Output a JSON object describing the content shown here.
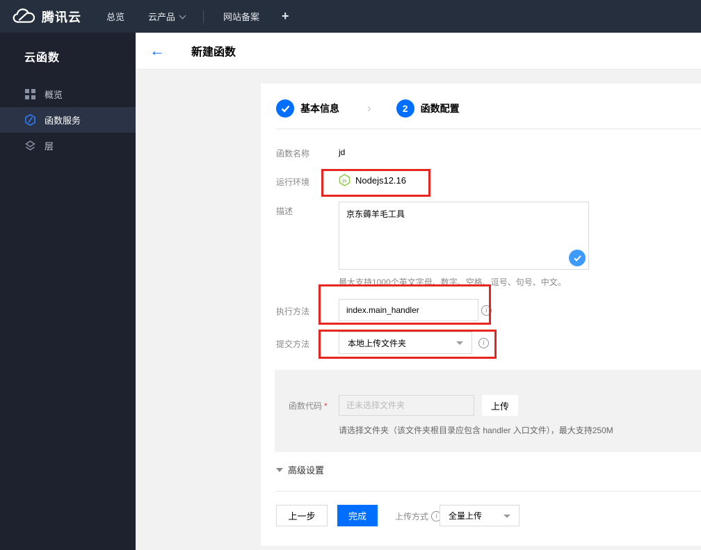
{
  "topnav": {
    "brand": "腾讯云",
    "items": [
      {
        "label": "总览"
      },
      {
        "label": "云产品"
      },
      {
        "label": "网站备案"
      },
      {
        "label": "+"
      }
    ]
  },
  "sidebar": {
    "title": "云函数",
    "items": [
      {
        "label": "概览",
        "active": false
      },
      {
        "label": "函数服务",
        "active": true
      },
      {
        "label": "层",
        "active": false
      }
    ]
  },
  "header": {
    "title": "新建函数"
  },
  "steps": [
    {
      "num": "1",
      "label": "基本信息",
      "state": "done"
    },
    {
      "num": "2",
      "label": "函数配置",
      "state": "current"
    }
  ],
  "form": {
    "function_name": {
      "label": "函数名称",
      "value": "jd"
    },
    "runtime": {
      "label": "运行环境",
      "value": "Nodejs12.16"
    },
    "description": {
      "label": "描述",
      "value": "京东薅羊毛工具",
      "helper": "最大支持1000个英文字母、数字、空格、逗号、句号、中文。"
    },
    "handler": {
      "label": "执行方法",
      "value": "index.main_handler"
    },
    "submit_method": {
      "label": "提交方法",
      "value": "本地上传文件夹"
    },
    "function_code": {
      "label": "函数代码",
      "required_mark": "*",
      "placeholder": "还未选择文件夹",
      "upload_button": "上传",
      "helper": "请选择文件夹（该文件夹根目录应包含 handler 入口文件），最大支持250M"
    },
    "advanced_label": "高级设置"
  },
  "footer": {
    "prev_button": "上一步",
    "finish_button": "完成",
    "upload_mode_label": "上传方式",
    "upload_mode_value": "全量上传"
  },
  "colors": {
    "accent_blue": "#006eff",
    "badge_blue": "#3d9bff",
    "annotation_red": "#e6261f",
    "node_green": "#8cc84b",
    "topnav_bg": "#262f3e",
    "sidebar_bg": "#1d222e",
    "sidebar_active_bg": "#2b3446",
    "content_bg": "#f2f2f2"
  }
}
